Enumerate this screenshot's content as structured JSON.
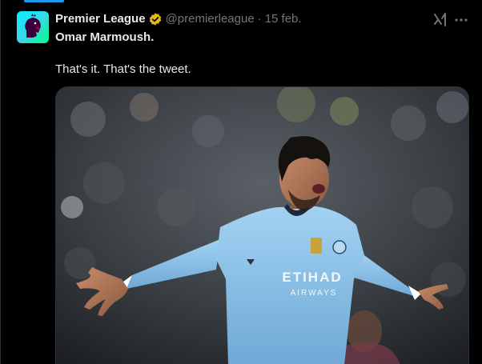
{
  "tweet": {
    "author_name": "Premier League",
    "handle": "@premierleague",
    "separator": "·",
    "date": "15 feb.",
    "headline": "Omar Marmoush.",
    "body": "That's it. That's the tweet."
  },
  "media": {
    "shirt_sponsor_line1": "ETIHAD",
    "shirt_sponsor_line2": "AIRWAYS"
  },
  "icons": {
    "verified": "verified-badge-gold-icon",
    "grok": "grok-icon",
    "more": "more-icon"
  },
  "colors": {
    "background": "#000000",
    "text_primary": "#e7e9ea",
    "text_secondary": "#71767b",
    "accent": "#1d9bf0",
    "verified_gold": "#e2b719",
    "shirt_blue": "#8ec3e8"
  }
}
